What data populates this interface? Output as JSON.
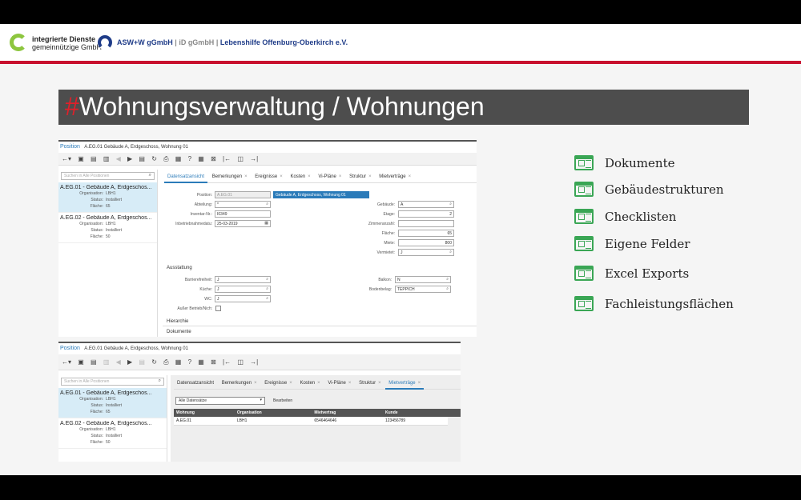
{
  "header": {
    "logo1_title": "integrierte Dienste",
    "logo1_sub": "gemeinnützige GmbH",
    "brand_asw": "ASW+W gGmbH",
    "sep1": "|",
    "brand_id": "iD gGmbH",
    "sep2": "|",
    "brand_lh": "Lebenshilfe Offenburg-Oberkirch e.V."
  },
  "title": {
    "hash": "#",
    "text": "Wohnungsverwaltung / Wohnungen"
  },
  "panel1": {
    "position_label": "Position",
    "position_path": "A.EG.01   Gebäude A, Erdgeschoss, Wohnung 01",
    "search_placeholder": "Suchen in Alle Positionen",
    "items": [
      {
        "name": "A.EG.01 - Gebäude A, Erdgeschos...",
        "org_k": "Organisation:",
        "org_v": "LBH1",
        "status_k": "Status:",
        "status_v": "Installiert",
        "flaeche_k": "Fläche:",
        "flaeche_v": "65"
      },
      {
        "name": "A.EG.02 - Gebäude A, Erdgeschos...",
        "org_k": "Organisation:",
        "org_v": "LBH1",
        "status_k": "Status:",
        "status_v": "Installiert",
        "flaeche_k": "Fläche:",
        "flaeche_v": "50"
      }
    ],
    "tabs": [
      "Datensatzansicht",
      "Bemerkungen",
      "Ereignisse",
      "Kosten",
      "Vi-Pläne",
      "Struktur",
      "Mietverträge"
    ],
    "form": {
      "position_l": "Position:",
      "position_v": "A.EG.01",
      "position_desc": "Gebäude A, Erdgeschoss, Wohnung 01",
      "abteilung_l": "Abteilung:",
      "abteilung_v": "*",
      "inventar_l": "Inventar-Nr.:",
      "inventar_v": "I0349",
      "inbetrieb_l": "Inbetriebnahmedatu:",
      "inbetrieb_v": "25-03-2019",
      "gebaeude_l": "Gebäude:",
      "gebaeude_v": "A",
      "etage_l": "Etage:",
      "etage_v": "2",
      "zimmer_l": "Zimmeranzahl:",
      "zimmer_v": "",
      "flaeche_l": "Fläche:",
      "flaeche_v": "65",
      "miete_l": "Miete:",
      "miete_v": "800",
      "vermietet_l": "Vermietet:",
      "vermietet_v": "J",
      "ausstattung": "Ausstattung",
      "barriere_l": "Barrierefreiheit:",
      "barriere_v": "J",
      "kueche_l": "Küche:",
      "kueche_v": "J",
      "wc_l": "WC:",
      "wc_v": "J",
      "ausser_l": "Außer Betrieb/Nich:",
      "balkon_l": "Balkon:",
      "balkon_v": "N",
      "boden_l": "Bodenbelag:",
      "boden_v": "TEPPICH",
      "hierarchie": "Hierarchie",
      "dokumente": "Dokumente"
    }
  },
  "panel2": {
    "position_label": "Position",
    "position_path": "A.EG.01   Gebäude A, Erdgeschoss, Wohnung 01",
    "search_placeholder": "Suchen in Alle Positionen",
    "items": [
      {
        "name": "A.EG.01 - Gebäude A, Erdgeschos...",
        "org_k": "Organisation:",
        "org_v": "LBH1",
        "status_k": "Status:",
        "status_v": "Installiert",
        "flaeche_k": "Fläche:",
        "flaeche_v": "65"
      },
      {
        "name": "A.EG.02 - Gebäude A, Erdgeschos...",
        "org_k": "Organisation:",
        "org_v": "LBH1",
        "status_k": "Status:",
        "status_v": "Installiert",
        "flaeche_k": "Fläche:",
        "flaeche_v": "50"
      }
    ],
    "tabs": [
      "Datensatzansicht",
      "Bemerkungen",
      "Ereignisse",
      "Kosten",
      "Vi-Pläne",
      "Struktur",
      "Mietverträge"
    ],
    "filter": "Alle Datensätze",
    "edit": "Bearbeiten",
    "columns": [
      "Wohnung",
      "Organisation",
      "Mietvertrag",
      "Kunde"
    ],
    "rows": [
      [
        "A.EG.01",
        "LBH1",
        "6546464646",
        "123456789"
      ]
    ]
  },
  "features": [
    "Dokumente",
    "Gebäudestrukturen",
    "Checklisten",
    "Eigene Felder",
    "Excel Exports",
    "Fachleistungsflächen"
  ],
  "colors": {
    "accent_red": "#c8102e",
    "feature_green": "#3aa655",
    "link_blue": "#2b7bb9"
  }
}
